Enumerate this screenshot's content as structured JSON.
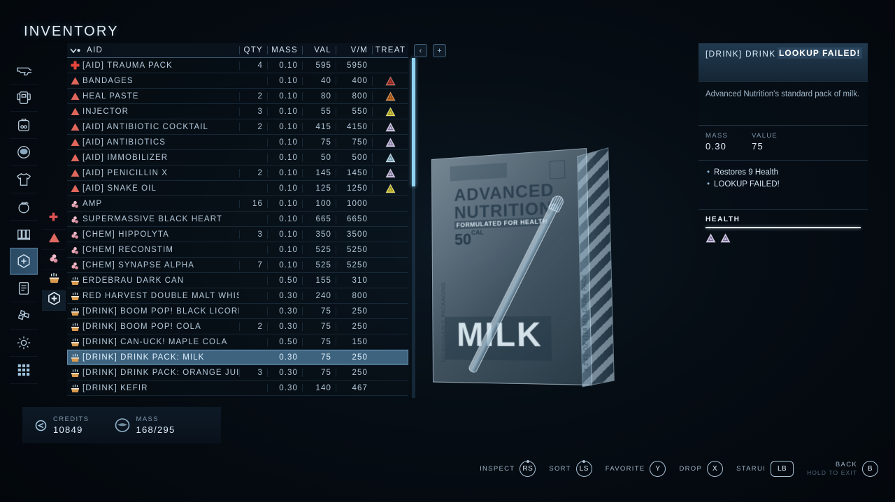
{
  "page": {
    "title": "INVENTORY"
  },
  "categories": [
    {
      "name": "weapons",
      "icon": "pistol-icon",
      "selected": false
    },
    {
      "name": "spacesuit",
      "icon": "spacesuit-icon",
      "selected": false
    },
    {
      "name": "pack",
      "icon": "backpack-icon",
      "selected": false
    },
    {
      "name": "helmet",
      "icon": "helmet-icon",
      "selected": false
    },
    {
      "name": "apparel",
      "icon": "shirt-icon",
      "selected": false
    },
    {
      "name": "throwable",
      "icon": "grenade-icon",
      "selected": false
    },
    {
      "name": "ammo",
      "icon": "ammo-icon",
      "selected": false
    },
    {
      "name": "aid",
      "icon": "aid-hexagon-icon",
      "selected": true
    },
    {
      "name": "notes",
      "icon": "document-icon",
      "selected": false
    },
    {
      "name": "resources",
      "icon": "resources-icon",
      "selected": false
    },
    {
      "name": "misc",
      "icon": "gear-icon",
      "selected": false
    },
    {
      "name": "all",
      "icon": "grid-icon",
      "selected": false
    }
  ],
  "subcategories": [
    {
      "name": "medkit",
      "icon": "red-cross-icon",
      "selected": false
    },
    {
      "name": "food",
      "icon": "red-triangle-icon",
      "selected": false
    },
    {
      "name": "chems",
      "icon": "chem-icon",
      "selected": false
    },
    {
      "name": "drinks",
      "icon": "drink-cup-icon",
      "selected": false
    },
    {
      "name": "aid-all",
      "icon": "aid-hexagon-icon",
      "selected": true
    }
  ],
  "table": {
    "sort_column": "AID",
    "headers": {
      "name": "AID",
      "qty": "QTY",
      "mass": "MASS",
      "val": "VAL",
      "vm": "V/M",
      "treat": "TREAT"
    },
    "rows": [
      {
        "icon": "medkit-cross-icon",
        "name": "[AID] TRAUMA PACK",
        "qty": "4",
        "mass": "0.10",
        "val": "595",
        "vm": "5950",
        "treat": ""
      },
      {
        "icon": "food-triangle-icon",
        "name": "BANDAGES",
        "qty": "",
        "mass": "0.10",
        "val": "40",
        "vm": "400",
        "treat": "#c0392b"
      },
      {
        "icon": "food-triangle-icon",
        "name": "HEAL PASTE",
        "qty": "2",
        "mass": "0.10",
        "val": "80",
        "vm": "800",
        "treat": "#d4711f"
      },
      {
        "icon": "food-triangle-icon",
        "name": "INJECTOR",
        "qty": "3",
        "mass": "0.10",
        "val": "55",
        "vm": "550",
        "treat": "#ddd13a"
      },
      {
        "icon": "food-triangle-icon",
        "name": "[AID] ANTIBIOTIC COCKTAIL",
        "qty": "2",
        "mass": "0.10",
        "val": "415",
        "vm": "4150",
        "treat": "#cbbde4"
      },
      {
        "icon": "food-triangle-icon",
        "name": "[AID] ANTIBIOTICS",
        "qty": "",
        "mass": "0.10",
        "val": "75",
        "vm": "750",
        "treat": "#cbbde4"
      },
      {
        "icon": "food-triangle-icon",
        "name": "[AID] IMMOBILIZER",
        "qty": "",
        "mass": "0.10",
        "val": "50",
        "vm": "500",
        "treat": "#a9cfe0"
      },
      {
        "icon": "food-triangle-icon",
        "name": "[AID] PENICILLIN X",
        "qty": "2",
        "mass": "0.10",
        "val": "145",
        "vm": "1450",
        "treat": "#cbbde4"
      },
      {
        "icon": "food-triangle-icon",
        "name": "[AID] SNAKE OIL",
        "qty": "",
        "mass": "0.10",
        "val": "125",
        "vm": "1250",
        "treat": "#ddd13a"
      },
      {
        "icon": "chem-icon",
        "name": "AMP",
        "qty": "16",
        "mass": "0.10",
        "val": "100",
        "vm": "1000",
        "treat": ""
      },
      {
        "icon": "chem-icon",
        "name": "SUPERMASSIVE BLACK HEART",
        "qty": "",
        "mass": "0.10",
        "val": "665",
        "vm": "6650",
        "treat": ""
      },
      {
        "icon": "chem-icon",
        "name": "[CHEM] HIPPOLYTA",
        "qty": "3",
        "mass": "0.10",
        "val": "350",
        "vm": "3500",
        "treat": ""
      },
      {
        "icon": "chem-icon",
        "name": "[CHEM] RECONSTIM",
        "qty": "",
        "mass": "0.10",
        "val": "525",
        "vm": "5250",
        "treat": ""
      },
      {
        "icon": "chem-icon",
        "name": "[CHEM] SYNAPSE ALPHA",
        "qty": "7",
        "mass": "0.10",
        "val": "525",
        "vm": "5250",
        "treat": ""
      },
      {
        "icon": "drink-cup-icon",
        "name": "ERDEBRAU DARK CAN",
        "qty": "",
        "mass": "0.50",
        "val": "155",
        "vm": "310",
        "treat": ""
      },
      {
        "icon": "drink-cup-icon",
        "name": "RED HARVEST DOUBLE MALT WHISKEY",
        "qty": "",
        "mass": "0.30",
        "val": "240",
        "vm": "800",
        "treat": ""
      },
      {
        "icon": "drink-cup-icon",
        "name": "[DRINK] BOOM POP! BLACK LICORICE",
        "qty": "",
        "mass": "0.30",
        "val": "75",
        "vm": "250",
        "treat": ""
      },
      {
        "icon": "drink-cup-icon",
        "name": "[DRINK] BOOM POP! COLA",
        "qty": "2",
        "mass": "0.30",
        "val": "75",
        "vm": "250",
        "treat": ""
      },
      {
        "icon": "drink-cup-icon",
        "name": "[DRINK] CAN-UCK! MAPLE COLA",
        "qty": "",
        "mass": "0.50",
        "val": "75",
        "vm": "150",
        "treat": ""
      },
      {
        "icon": "drink-cup-icon",
        "name": "[DRINK] DRINK PACK: MILK",
        "qty": "",
        "mass": "0.30",
        "val": "75",
        "vm": "250",
        "treat": "",
        "selected": true
      },
      {
        "icon": "drink-cup-icon",
        "name": "[DRINK] DRINK PACK: ORANGE JUICE",
        "qty": "3",
        "mass": "0.30",
        "val": "75",
        "vm": "250",
        "treat": ""
      },
      {
        "icon": "drink-cup-icon",
        "name": "[DRINK] KEFIR",
        "qty": "",
        "mass": "0.30",
        "val": "140",
        "vm": "467",
        "treat": ""
      }
    ]
  },
  "nav_buttons": {
    "prev": "‹",
    "add": "+"
  },
  "detail": {
    "title": "[DRINK] DRINK PACK: MILK",
    "title_overlay": "LOOKUP FAILED!",
    "description": "Advanced Nutrition's standard pack of milk.",
    "mass_label": "MASS",
    "mass_value": "0.30",
    "value_label": "VALUE",
    "value_value": "75",
    "effects": [
      "Restores 9 Health",
      "LOOKUP FAILED!"
    ],
    "resist_label": "HEALTH"
  },
  "preview": {
    "brand_line1": "ADVANCED",
    "brand_line2": "NUTRITION",
    "tagline": "FORMULATED FOR HEALTH",
    "calories": "50",
    "calories_unit": "CAL",
    "product": "MILK",
    "side_left_text": "NO REUSABLE PACKAGING",
    "side_right_text": "4.2 FL OZ (118 ML) DRINK PACK"
  },
  "bottom": {
    "credits_label": "CREDITS",
    "credits_value": "10849",
    "mass_label": "MASS",
    "mass_value": "168/295"
  },
  "hints": [
    {
      "label": "INSPECT",
      "button": "RS",
      "shape": "stick"
    },
    {
      "label": "SORT",
      "button": "LS",
      "shape": "stick"
    },
    {
      "label": "FAVORITE",
      "button": "Y",
      "shape": "round"
    },
    {
      "label": "DROP",
      "button": "X",
      "shape": "round"
    },
    {
      "label": "STARUI",
      "button": "LB",
      "shape": "pill"
    },
    {
      "label": "BACK",
      "sub": "HOLD TO EXIT",
      "button": "B",
      "shape": "round"
    }
  ],
  "colors": {
    "accent": "#8fd2f2",
    "selected_row": "#3e637f",
    "background": "#03070c"
  }
}
